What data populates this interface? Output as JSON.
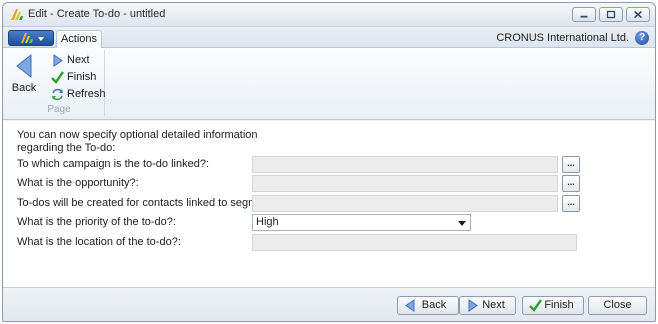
{
  "window": {
    "title": "Edit - Create To-do - untitled"
  },
  "ribbon": {
    "tab_actions": "Actions",
    "company": "CRONUS International Ltd.",
    "help_glyph": "?",
    "page_group": {
      "label": "Page",
      "back_label": "Back",
      "next_label": "Next",
      "finish_label": "Finish",
      "refresh_label": "Refresh"
    }
  },
  "form": {
    "intro": "You can now specify optional detailed information regarding the To-do:",
    "fields": [
      {
        "label": "To which campaign is the to-do linked?:",
        "value": "",
        "assist": "..."
      },
      {
        "label": "What is the opportunity?:",
        "value": "",
        "assist": "..."
      },
      {
        "label": "To-dos will be created for contacts linked to segment:",
        "value": "",
        "assist": "..."
      },
      {
        "label": "What is the priority of the to-do?:",
        "value": "High"
      },
      {
        "label": "What is the location of the to-do?:",
        "value": ""
      }
    ]
  },
  "footer": {
    "back_label": "Back",
    "next_label": "Next",
    "finish_label": "Finish",
    "close_label": "Close"
  },
  "icons": {
    "app_logo": "dynamics-nav-logo-icon",
    "back": "back-arrow-icon",
    "next": "next-arrow-icon",
    "finish": "green-check-icon",
    "refresh": "refresh-icon",
    "help": "help-icon",
    "dropdown": "chevron-down-icon"
  },
  "colors": {
    "titlebar": "#dfe6ef",
    "app_menu": "#1f4f9c",
    "finish_check": "#2ea12e",
    "nav_arrow": "#5f8fd6",
    "disabled_field": "#ececec"
  }
}
